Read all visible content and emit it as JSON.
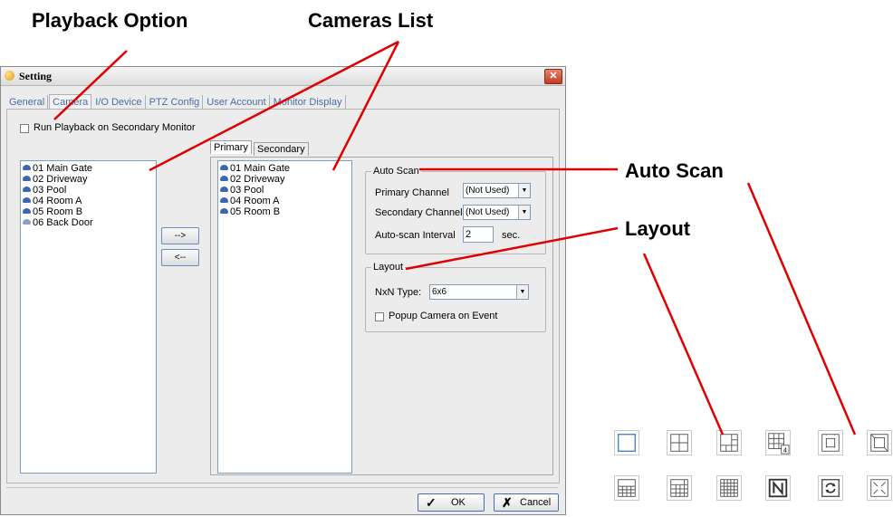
{
  "callouts": {
    "playback": "Playback Option",
    "cameras": "Cameras List",
    "autoscan": "Auto Scan",
    "layout": "Layout"
  },
  "window": {
    "title": "Setting",
    "close_label": "✕",
    "tabs": [
      "General",
      "Camera",
      "I/O Device",
      "PTZ Config",
      "User Account",
      "Monitor Display"
    ],
    "active_tab": "Camera"
  },
  "playback": {
    "label": "Run Playback on Secondary Monitor",
    "checked": false
  },
  "left_list": [
    "01 Main Gate",
    "02 Driveway",
    "03 Pool",
    "04 Room A",
    "05 Room B",
    "06 Back Door"
  ],
  "move_buttons": {
    "right": "-->",
    "left": "<--"
  },
  "subtabs": [
    "Primary",
    "Secondary"
  ],
  "primary_list": [
    "01 Main Gate",
    "02 Driveway",
    "03 Pool",
    "04 Room A",
    "05 Room B"
  ],
  "auto_scan": {
    "title": "Auto Scan",
    "primary_label": "Primary Channel",
    "primary_value": "(Not Used)",
    "secondary_label": "Secondary Channel",
    "secondary_value": "(Not Used)",
    "interval_label": "Auto-scan Interval",
    "interval_value": "2",
    "interval_unit": "sec."
  },
  "layout": {
    "title": "Layout",
    "nxn_label": "NxN Type:",
    "nxn_value": "6x6",
    "popup_label": "Popup Camera on Event",
    "popup_checked": false
  },
  "footer": {
    "ok": "OK",
    "cancel": "Cancel"
  },
  "layout_icons": {
    "row1": [
      "single-view-icon",
      "quad-view-icon",
      "1-plus-5-view-icon",
      "3x3-plus-4-view-icon",
      "1-plus-12-view-icon",
      "1-plus-7-view-icon"
    ],
    "row2": [
      "4x4-view-icon",
      "5x5-view-icon",
      "6x6-view-icon",
      "nxn-view-icon",
      "auto-scan-icon",
      "fullscreen-icon"
    ],
    "badge": "4"
  }
}
